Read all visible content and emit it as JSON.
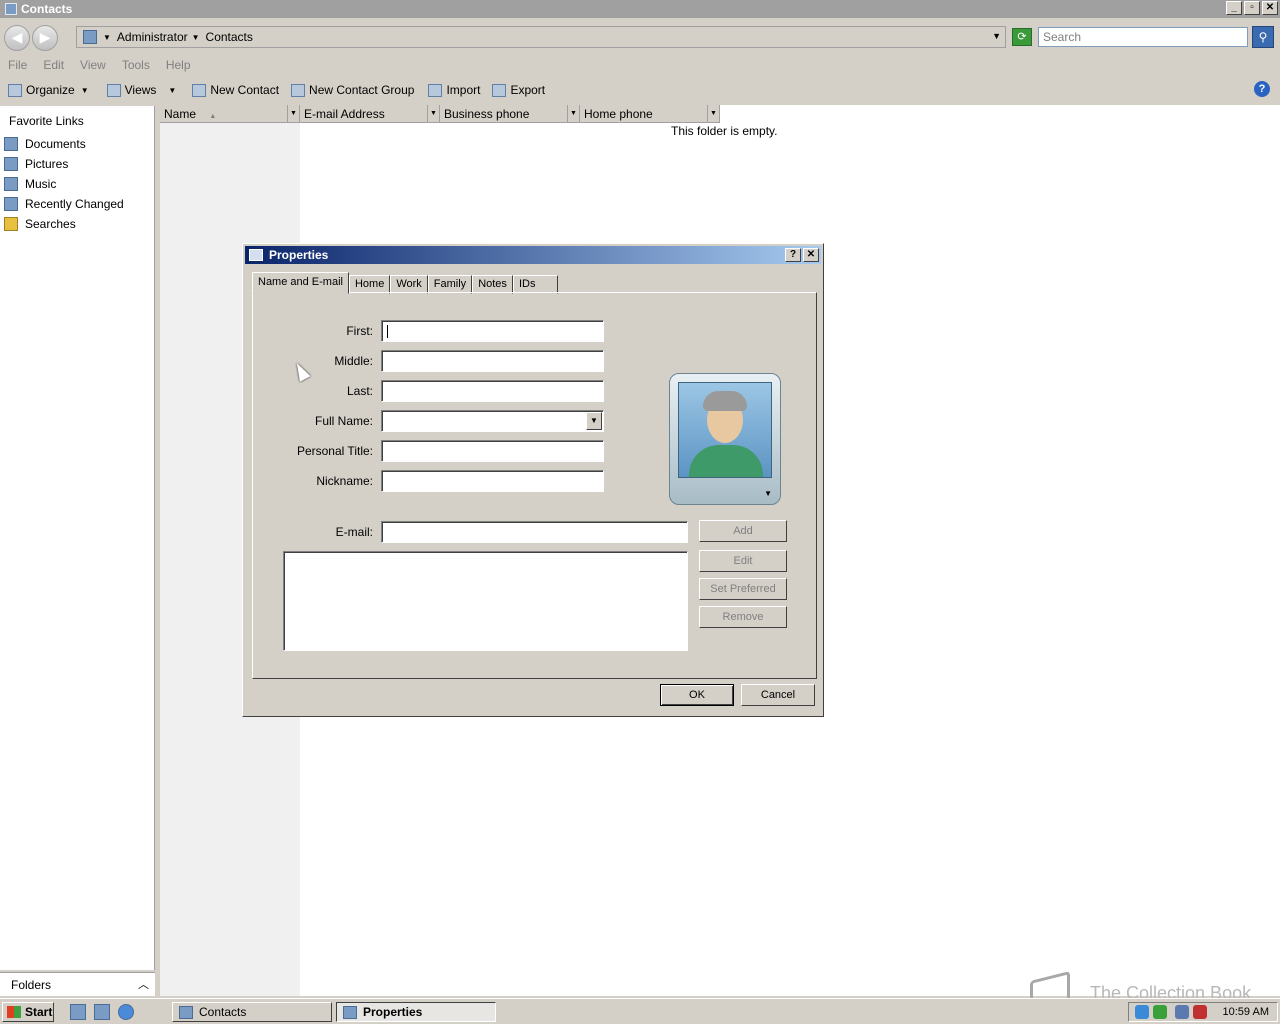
{
  "window": {
    "title": "Contacts",
    "controls": [
      "_",
      "▫",
      "✕"
    ]
  },
  "address": {
    "crumbs": [
      "Administrator",
      "Contacts"
    ],
    "search_placeholder": "Search"
  },
  "menu": [
    "File",
    "Edit",
    "View",
    "Tools",
    "Help"
  ],
  "toolbar": {
    "organize": "Organize",
    "views": "Views",
    "new_contact": "New Contact",
    "new_contact_group": "New Contact Group",
    "import": "Import",
    "export": "Export",
    "help": "?"
  },
  "nav": {
    "title": "Favorite Links",
    "items": [
      "Documents",
      "Pictures",
      "Music",
      "Recently Changed",
      "Searches"
    ],
    "folders": "Folders"
  },
  "columns": [
    {
      "label": "Name",
      "sort": "▲"
    },
    {
      "label": "E-mail Address"
    },
    {
      "label": "Business phone"
    },
    {
      "label": "Home phone"
    }
  ],
  "content": {
    "empty_message": "This folder is empty."
  },
  "dialog": {
    "title": "Properties",
    "controls": [
      "?",
      "✕"
    ],
    "tabs": [
      "Name and E-mail",
      "Home",
      "Work",
      "Family",
      "Notes",
      "IDs"
    ],
    "active_tab": "Name and E-mail",
    "fields": {
      "first": "First:",
      "middle": "Middle:",
      "last": "Last:",
      "full_name": "Full Name:",
      "personal_title": "Personal Title:",
      "nickname": "Nickname:",
      "email": "E-mail:"
    },
    "values": {
      "first": "",
      "middle": "",
      "last": "",
      "full_name": "",
      "personal_title": "",
      "nickname": "",
      "email": ""
    },
    "buttons": {
      "add": "Add",
      "edit": "Edit",
      "set_preferred": "Set Preferred",
      "remove": "Remove",
      "ok": "OK",
      "cancel": "Cancel"
    }
  },
  "taskbar": {
    "start": "Start",
    "tasks": [
      "Contacts",
      "Properties"
    ],
    "active_task": "Properties",
    "clock": "10:59 AM"
  },
  "watermark": "The Collection Book"
}
